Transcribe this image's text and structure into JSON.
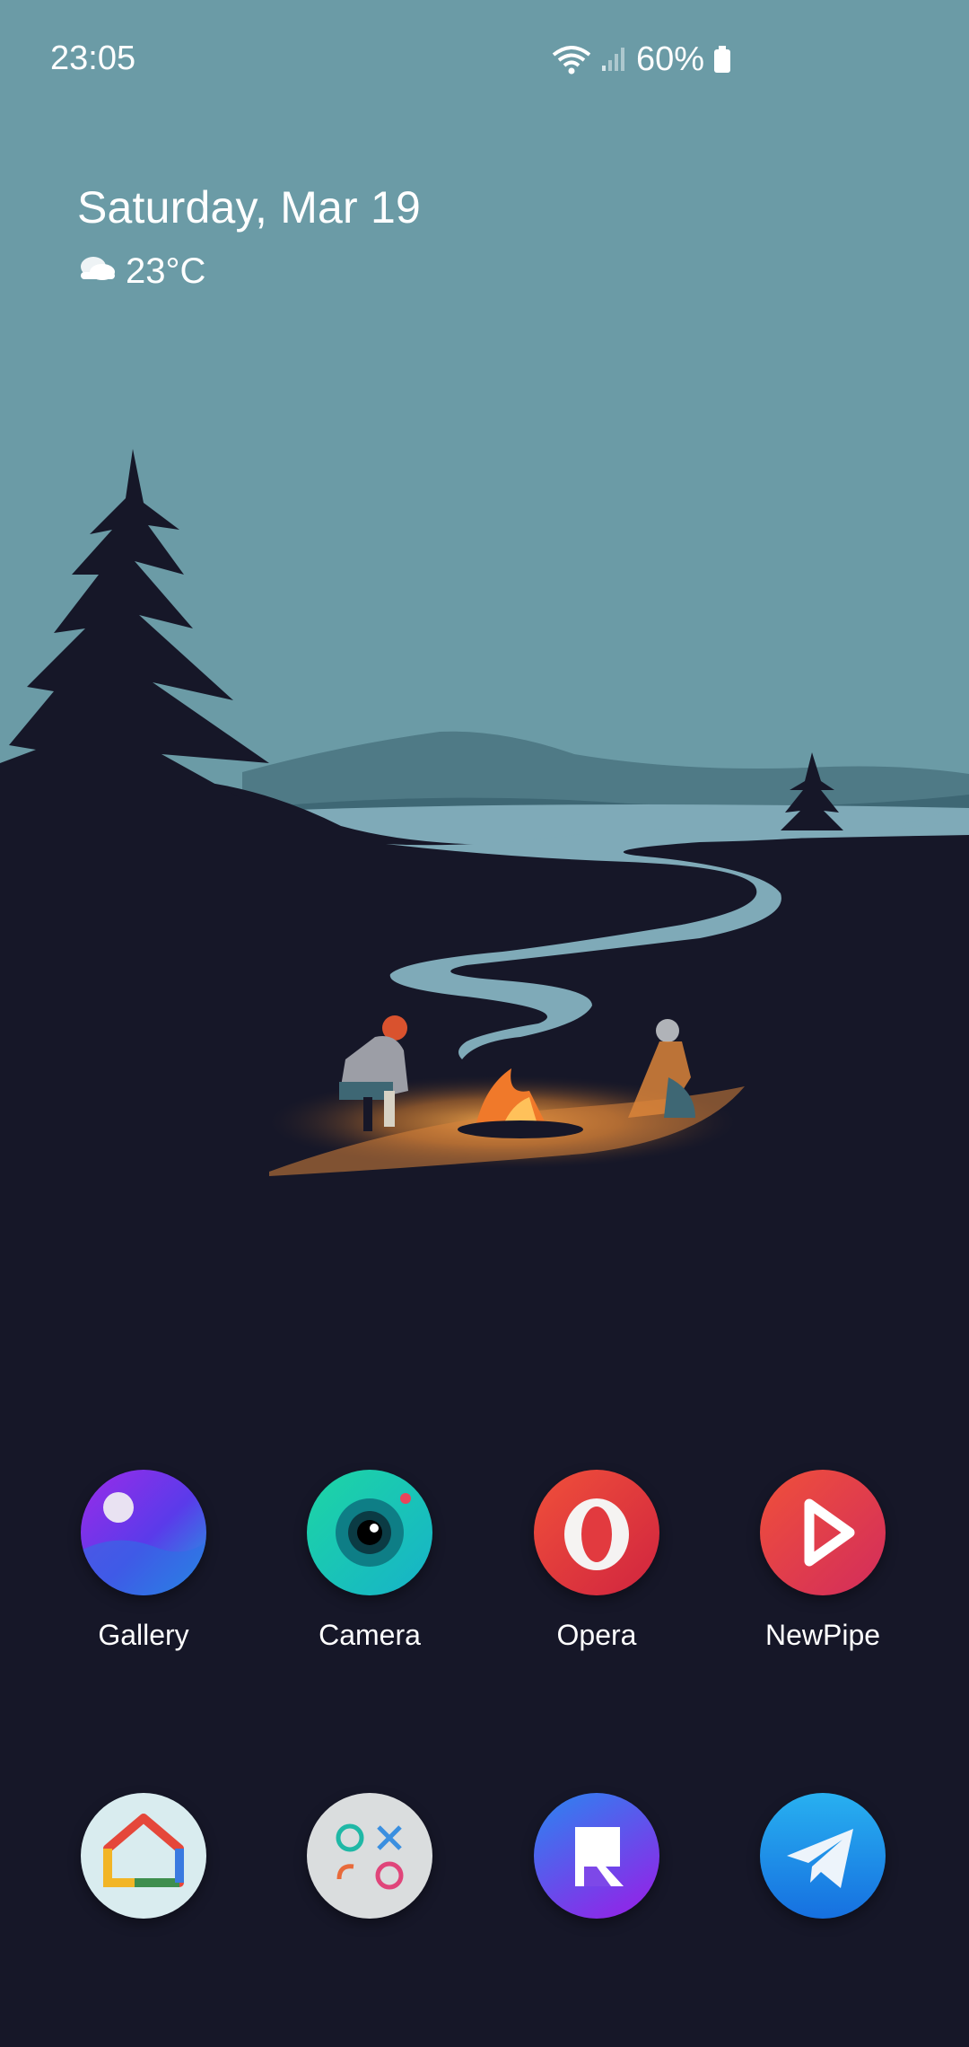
{
  "status_bar": {
    "time": "23:05",
    "battery": "60%",
    "icons": [
      "wifi-icon",
      "cellular-signal-icon",
      "battery-icon"
    ]
  },
  "widget": {
    "date": "Saturday, Mar 19",
    "weather_icon": "cloud-icon",
    "temperature": "23°C"
  },
  "dock_row_1": [
    {
      "label": "Gallery",
      "icon": "gallery-icon"
    },
    {
      "label": "Camera",
      "icon": "camera-icon"
    },
    {
      "label": "Opera",
      "icon": "opera-icon"
    },
    {
      "label": "NewPipe",
      "icon": "newpipe-icon"
    }
  ],
  "dock_row_2": [
    {
      "label": "",
      "icon": "home-app-icon"
    },
    {
      "label": "",
      "icon": "game-app-icon"
    },
    {
      "label": "",
      "icon": "reddit-r-app-icon"
    },
    {
      "label": "",
      "icon": "telegram-icon"
    }
  ],
  "colors": {
    "sky": "#6B9BA6",
    "ground": "#161728",
    "river": "#7FAAB8",
    "fire": "#F08A2E"
  }
}
